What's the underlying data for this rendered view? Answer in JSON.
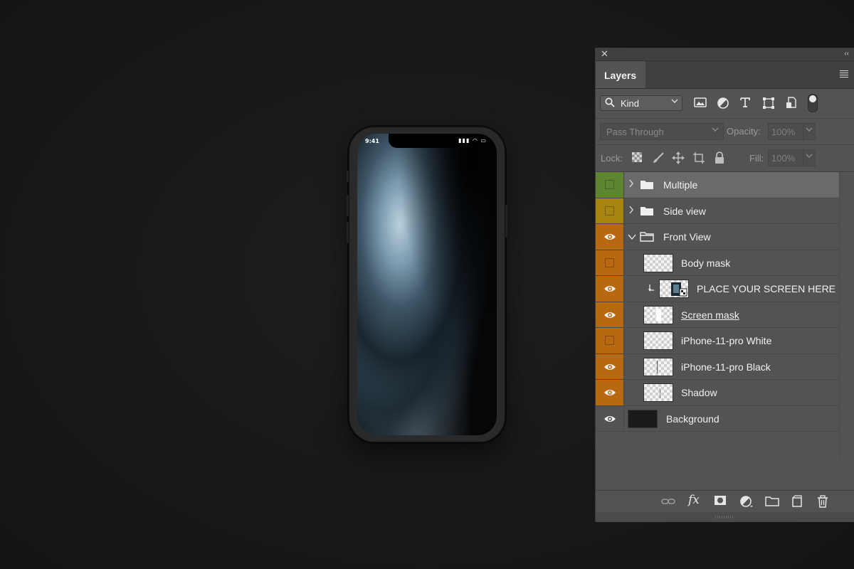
{
  "phone": {
    "status_time": "9:41",
    "status_icons": "▮▮▮ ◠ ▭"
  },
  "panel": {
    "tab_label": "Layers",
    "close_glyph": "✕",
    "collapse_glyph": "‹‹",
    "filter": {
      "kind_label": "Kind"
    },
    "blend_mode": "Pass Through",
    "opacity_label": "Opacity:",
    "opacity_value": "100%",
    "lock_label": "Lock:",
    "fill_label": "Fill:",
    "fill_value": "100%"
  },
  "colors": {
    "green": "#5e8632",
    "yellow": "#a88410",
    "orange": "#b8690f",
    "selected_row": "#6a6a6a",
    "panel_bg": "#535353"
  },
  "layers": [
    {
      "name": "Multiple",
      "color": "green",
      "visible": false,
      "type": "group",
      "expanded": false,
      "selected": true
    },
    {
      "name": "Side view",
      "color": "yellow",
      "visible": false,
      "type": "group",
      "expanded": false
    },
    {
      "name": "Front View",
      "color": "orange",
      "visible": true,
      "type": "group",
      "expanded": true
    },
    {
      "name": "Body mask",
      "color": "orange",
      "visible": false,
      "type": "layer"
    },
    {
      "name": "PLACE YOUR SCREEN HERE",
      "color": "orange",
      "visible": true,
      "type": "smart",
      "clipped": true
    },
    {
      "name": "Screen mask",
      "color": "orange",
      "visible": true,
      "type": "layer",
      "underlined": true
    },
    {
      "name": "iPhone-11-pro White",
      "color": "orange",
      "visible": false,
      "type": "layer"
    },
    {
      "name": "iPhone-11-pro Black",
      "color": "orange",
      "visible": true,
      "type": "layer"
    },
    {
      "name": "Shadow",
      "color": "orange",
      "visible": true,
      "type": "layer"
    },
    {
      "name": "Background",
      "color": "none",
      "visible": true,
      "type": "background"
    }
  ],
  "footer_icons": [
    "link-icon",
    "fx-icon",
    "mask-icon",
    "adjustment-icon",
    "new-group-icon",
    "new-layer-icon",
    "trash-icon"
  ],
  "footer_fx_label": "fx"
}
